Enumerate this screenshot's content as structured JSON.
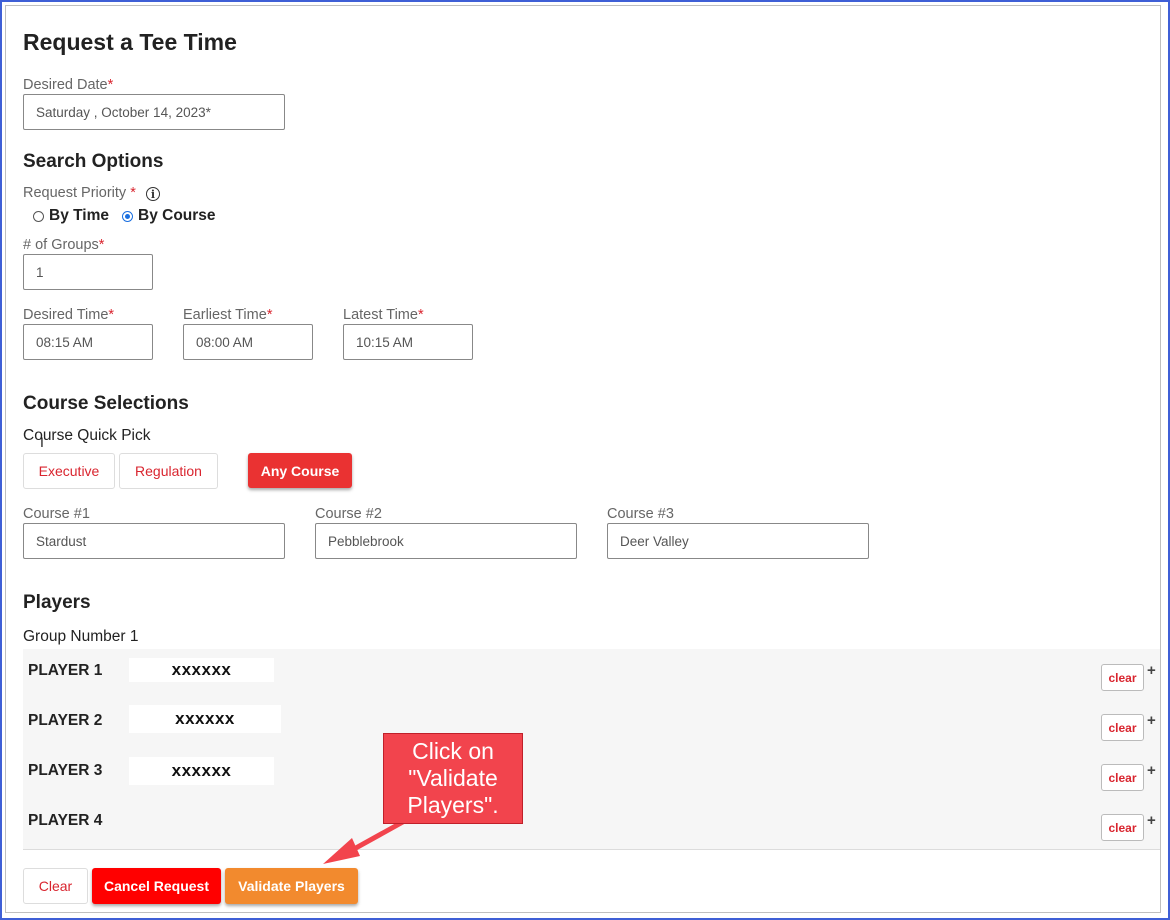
{
  "page": {
    "title": "Request a Tee Time"
  },
  "date": {
    "label": "Desired Date",
    "required_mark": "*",
    "value": "Saturday , October 14, 2023*"
  },
  "search_options": {
    "heading": "Search Options",
    "priority_label": "Request Priority",
    "priority_required": "*",
    "info_icon": "i",
    "options": [
      {
        "label": "By Time",
        "checked": false
      },
      {
        "label": "By Course",
        "checked": true
      }
    ],
    "groups_label": "# of Groups",
    "groups_required": "*",
    "groups_value": "1",
    "desired_time_label": "Desired Time",
    "desired_time_value": "08:15 AM",
    "earliest_time_label": "Earliest Time",
    "earliest_time_value": "08:00 AM",
    "latest_time_label": "Latest Time",
    "latest_time_value": "10:15 AM",
    "required_mark": "*"
  },
  "course_selections": {
    "heading": "Course Selections",
    "quick_pick_label": "Course Quick Pick",
    "quick_pick_buttons": [
      "Executive",
      "Regulation",
      "Any Course"
    ],
    "course1_label": "Course #1",
    "course1_value": "Stardust",
    "course2_label": "Course #2",
    "course2_value": "Pebblebrook",
    "course3_label": "Course #3",
    "course3_value": "Deer Valley"
  },
  "players": {
    "heading": "Players",
    "group_label": "Group Number 1",
    "rows": [
      {
        "name": "PLAYER 1",
        "value": "xxxxxx"
      },
      {
        "name": "PLAYER 2",
        "value": "xxxxxx"
      },
      {
        "name": "PLAYER 3",
        "value": "xxxxxx"
      },
      {
        "name": "PLAYER 4",
        "value": ""
      }
    ],
    "clear_label": "clear",
    "plus_icon": "+"
  },
  "actions": {
    "clear": "Clear",
    "cancel": "Cancel Request",
    "validate": "Validate Players"
  },
  "callout": {
    "text": "Click on\n\"Validate\nPlayers\"."
  },
  "colors": {
    "accent_red": "#ea3232",
    "cancel_red": "#ff0000",
    "validate_orange": "#f28a2e",
    "callout_red": "#f2444d",
    "frame_blue": "#3f5fd6"
  }
}
